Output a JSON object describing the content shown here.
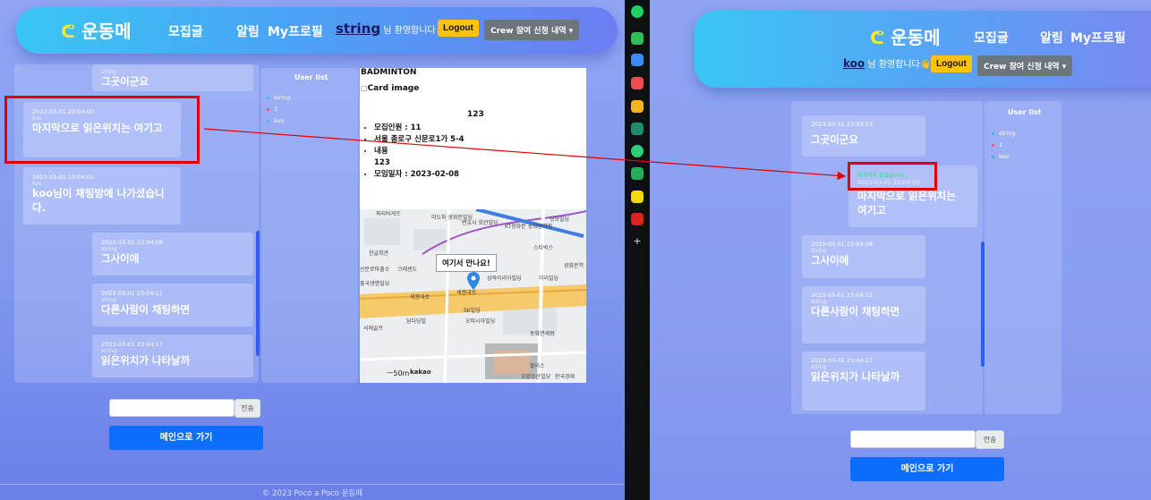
{
  "left": {
    "nav": {
      "logo": "운동메",
      "recruit": "모집글",
      "notifications": "알림",
      "profile": "My프로필",
      "username": "string",
      "welcome": "님 환영합니다👋",
      "logout": "Logout",
      "crew_menu": "Crew 참여 신청 내역 ▾"
    },
    "messages": [
      {
        "ts": "",
        "sender": "string",
        "body": "그곳이군요"
      },
      {
        "ts": "2023-03-01 23:04:00",
        "sender": "koo",
        "body": "마지막으로 읽은위치는 여기고"
      },
      {
        "ts": "2023-03-01 23:04:02",
        "sender": "koo",
        "body": "koo님이 채팅방에 나가셨습니다."
      },
      {
        "ts": "2023-03-01 23:04:08",
        "sender": "string",
        "body": "그사이에"
      },
      {
        "ts": "2023-03-01 23:04:11",
        "sender": "string",
        "body": "다른사람이 채팅하면"
      },
      {
        "ts": "2023-03-01 23:04:17",
        "sender": "string",
        "body": "읽은위치가 나타날까"
      }
    ],
    "user_list": {
      "title": "User list",
      "users": [
        {
          "name": "string",
          "color": "#2cc0e8"
        },
        {
          "name": "1",
          "color": "#ff4f6e"
        },
        {
          "name": "koo",
          "color": "#2cc0e8"
        }
      ]
    },
    "card": {
      "title": "BADMINTON",
      "image_alt": "Card image",
      "number": "123",
      "details": [
        "모집인원 : 11",
        "서울 종로구 신문로1가 5-4",
        "내용",
        "123",
        "모임일자 : 2023-02-08"
      ],
      "map_meet_label": "여기서 만나요!",
      "map_labels": [
        "파리바게뜨",
        "미도파 광화문빌딩",
        "변호사 회관빌딩",
        "KT광화문 광화문역점",
        "성보빌딩",
        "한글회관",
        "신문로파출소",
        "크레센도",
        "흥국생명빌딩",
        "성북이리아빌딩",
        "스타벅스",
        "SK빌딩",
        "이리빌딩",
        "광화문역",
        "세종대로",
        "담다당빌",
        "오피시아빌딩",
        "세종대로",
        "동화면세점",
        "할리스",
        "서애골프",
        "오양수산빌딩",
        "한국경제"
      ],
      "map_scale": "50m",
      "map_brand": "kakao"
    },
    "input_placeholder": "",
    "send_label": "전송",
    "main_button": "메인으로 가기",
    "footer": "© 2023 Poco a Poco 운동메"
  },
  "right": {
    "nav": {
      "logo": "운동메",
      "recruit": "모집글",
      "notifications": "알림",
      "profile": "My프로필",
      "username": "koo",
      "welcome": "님 환영합니다👋",
      "logout": "Logout",
      "crew_menu": "Crew 참여 신청 내역 ▾"
    },
    "messages": [
      {
        "ts": "2023-03-01 23:03:23",
        "sender": "",
        "body": "그곳이군요"
      },
      {
        "ts": "2023-03-01 23:04:00",
        "sender": "",
        "body": "마지막으로 읽은위치는 여기고",
        "read_marker": "여기까지 읽었습니다."
      },
      {
        "ts": "2023-03-01 23:04:08",
        "sender": "string",
        "body": "그사이에"
      },
      {
        "ts": "2023-03-01 23:04:11",
        "sender": "string",
        "body": "다른사람이 채팅하면"
      },
      {
        "ts": "2023-03-01 23:04:17",
        "sender": "string",
        "body": "읽은위치가 나타날까"
      }
    ],
    "user_list": {
      "title": "User list",
      "users": [
        {
          "name": "string",
          "color": "#2cc0e8"
        },
        {
          "name": "1",
          "color": "#ff4f6e"
        },
        {
          "name": "koo",
          "color": "#2cc0e8"
        }
      ]
    },
    "send_label": "전송",
    "main_button": "메인으로 가기"
  },
  "colors": {
    "accent_blue": "#0d6efd",
    "logout_yellow": "#ffc20e",
    "highlight_red": "#e00000",
    "read_marker_green": "#1fe07a"
  }
}
